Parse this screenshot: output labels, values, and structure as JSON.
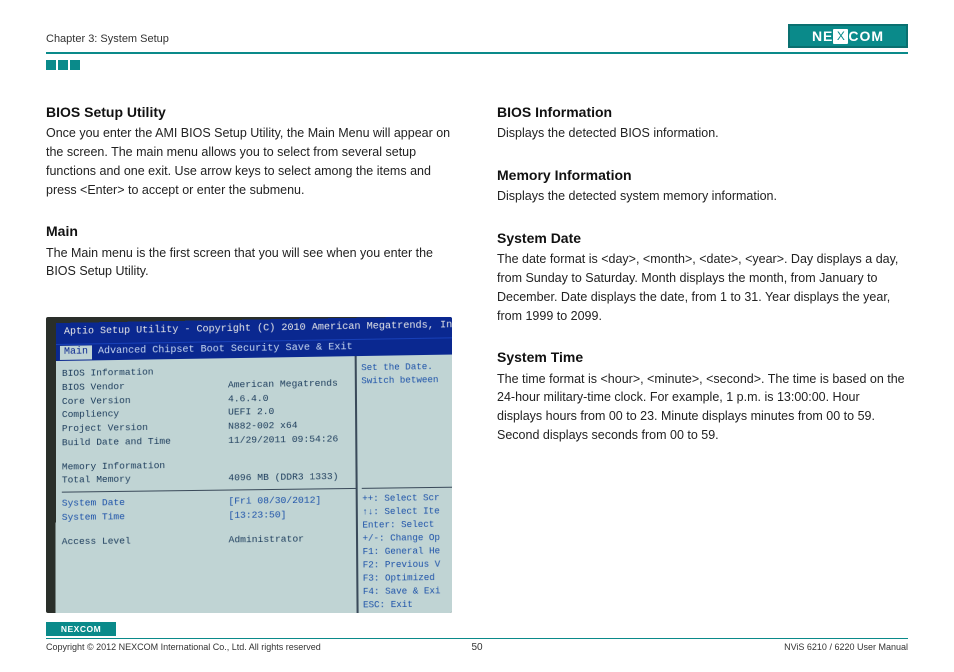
{
  "header": {
    "chapter": "Chapter 3: System Setup",
    "logo_text": "NECOM",
    "logo_x": "X"
  },
  "left": {
    "h1": "BIOS Setup Utility",
    "p1": "Once you enter the AMI BIOS Setup Utility, the Main Menu will appear on the screen. The main menu allows you to select from several setup functions and one exit. Use arrow keys to select among the items and press <Enter> to accept or enter the submenu.",
    "h2": "Main",
    "p2": "The Main menu is the first screen that you will see when you enter the BIOS Setup Utility."
  },
  "right": {
    "h1": "BIOS Information",
    "p1": "Displays the detected BIOS information.",
    "h2": "Memory Information",
    "p2": "Displays the detected system memory information.",
    "h3": "System Date",
    "p3": "The date format is <day>, <month>, <date>, <year>. Day displays a day, from Sunday to Saturday. Month displays the month, from January to December. Date displays the date, from 1 to 31. Year displays the year, from 1999 to 2099.",
    "h4": "System Time",
    "p4": "The time format is <hour>, <minute>, <second>. The time is based on the 24-hour military-time clock. For example, 1 p.m. is 13:00:00. Hour displays hours from 00 to 23. Minute displays minutes from 00 to 59. Second displays seconds from 00 to 59."
  },
  "bios": {
    "title": "Aptio Setup Utility - Copyright (C) 2010 American Megatrends, In",
    "tabs": {
      "t0": "Main",
      "rest": "Advanced  Chipset  Boot  Security  Save & Exit"
    },
    "section1": "BIOS Information",
    "r1l": "BIOS Vendor",
    "r1v": "American Megatrends",
    "r2l": "Core Version",
    "r2v": "4.6.4.0",
    "r3l": "Compliency",
    "r3v": "UEFI 2.0",
    "r4l": "Project Version",
    "r4v": "N882-002 x64",
    "r5l": "Build Date and Time",
    "r5v": "11/29/2011 09:54:26",
    "section2": "Memory Information",
    "r6l": "Total Memory",
    "r6v": "4096 MB (DDR3 1333)",
    "r7l": "System Date",
    "r7v": "[Fri 08/30/2012]",
    "r8l": "System Time",
    "r8v": "[13:23:50]",
    "r9l": "Access Level",
    "r9v": "Administrator",
    "help1": "Set the Date.",
    "help2": "Switch between",
    "k1": "++: Select Scr",
    "k2": "↑↓: Select Ite",
    "k3": "Enter: Select",
    "k4": "+/-: Change Op",
    "k5": "F1: General He",
    "k6": "F2: Previous V",
    "k7": "F3: Optimized",
    "k8": "F4: Save & Exi",
    "k9": "ESC: Exit"
  },
  "footer": {
    "logo_text": "NEXCOM",
    "copyright": "Copyright © 2012 NEXCOM International Co., Ltd. All rights reserved",
    "page": "50",
    "manual": "NViS 6210 / 6220 User Manual"
  }
}
